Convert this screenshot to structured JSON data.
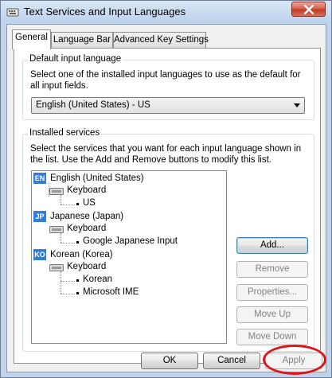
{
  "window": {
    "title": "Text Services and Input Languages",
    "close_icon": "close-icon"
  },
  "tabs": [
    {
      "label": "General",
      "active": true
    },
    {
      "label": "Language Bar",
      "active": false
    },
    {
      "label": "Advanced Key Settings",
      "active": false
    }
  ],
  "default_input": {
    "group_title": "Default input language",
    "description": "Select one of the installed input languages to use as the default for all input fields.",
    "selected": "English (United States) - US"
  },
  "installed_services": {
    "group_title": "Installed services",
    "description": "Select the services that you want for each input language shown in the list. Use the Add and Remove buttons to modify this list.",
    "tree": [
      {
        "badge": "EN",
        "label": "English (United States)",
        "category": "Keyboard",
        "items": [
          "US"
        ]
      },
      {
        "badge": "JP",
        "label": "Japanese (Japan)",
        "category": "Keyboard",
        "items": [
          "Google Japanese Input"
        ]
      },
      {
        "badge": "KO",
        "label": "Korean (Korea)",
        "category": "Keyboard",
        "items": [
          "Korean",
          "Microsoft IME"
        ]
      }
    ],
    "buttons": {
      "add": "Add...",
      "remove": "Remove",
      "properties": "Properties...",
      "move_up": "Move Up",
      "move_down": "Move Down"
    }
  },
  "footer": {
    "ok": "OK",
    "cancel": "Cancel",
    "apply": "Apply"
  },
  "colors": {
    "badge": "#2f7fd9",
    "annotation_circle": "#e0141a"
  }
}
